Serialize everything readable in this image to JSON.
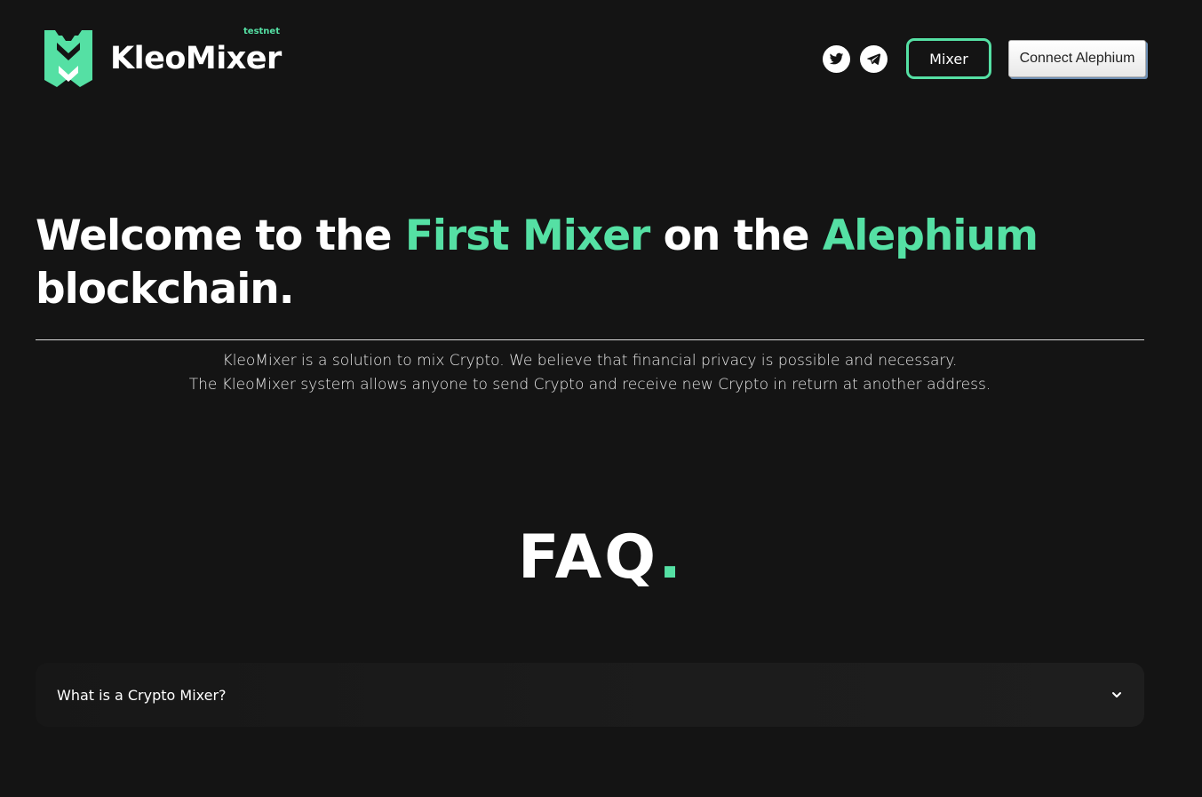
{
  "header": {
    "brand": "KleoMixer",
    "badge": "testnet",
    "social": [
      {
        "icon": "twitter-icon"
      },
      {
        "icon": "telegram-icon"
      }
    ],
    "mixer_label": "Mixer",
    "connect_label": "Connect Alephium"
  },
  "hero": {
    "title_part1": "Welcome to the ",
    "title_accent1": "First Mixer",
    "title_part2": " on the ",
    "title_accent2": "Alephium",
    "title_part3": " blockchain.",
    "desc_line1": "KleoMixer is a solution to mix Crypto. We believe that financial privacy is possible and necessary.",
    "desc_line2": "The KleoMixer system allows anyone to send Crypto and receive new Crypto in return at another address."
  },
  "faq": {
    "title": "FAQ",
    "dot": ".",
    "items": [
      {
        "question": "What is a Crypto Mixer?"
      }
    ]
  },
  "colors": {
    "background": "#141414",
    "accent": "#55e0a4"
  }
}
